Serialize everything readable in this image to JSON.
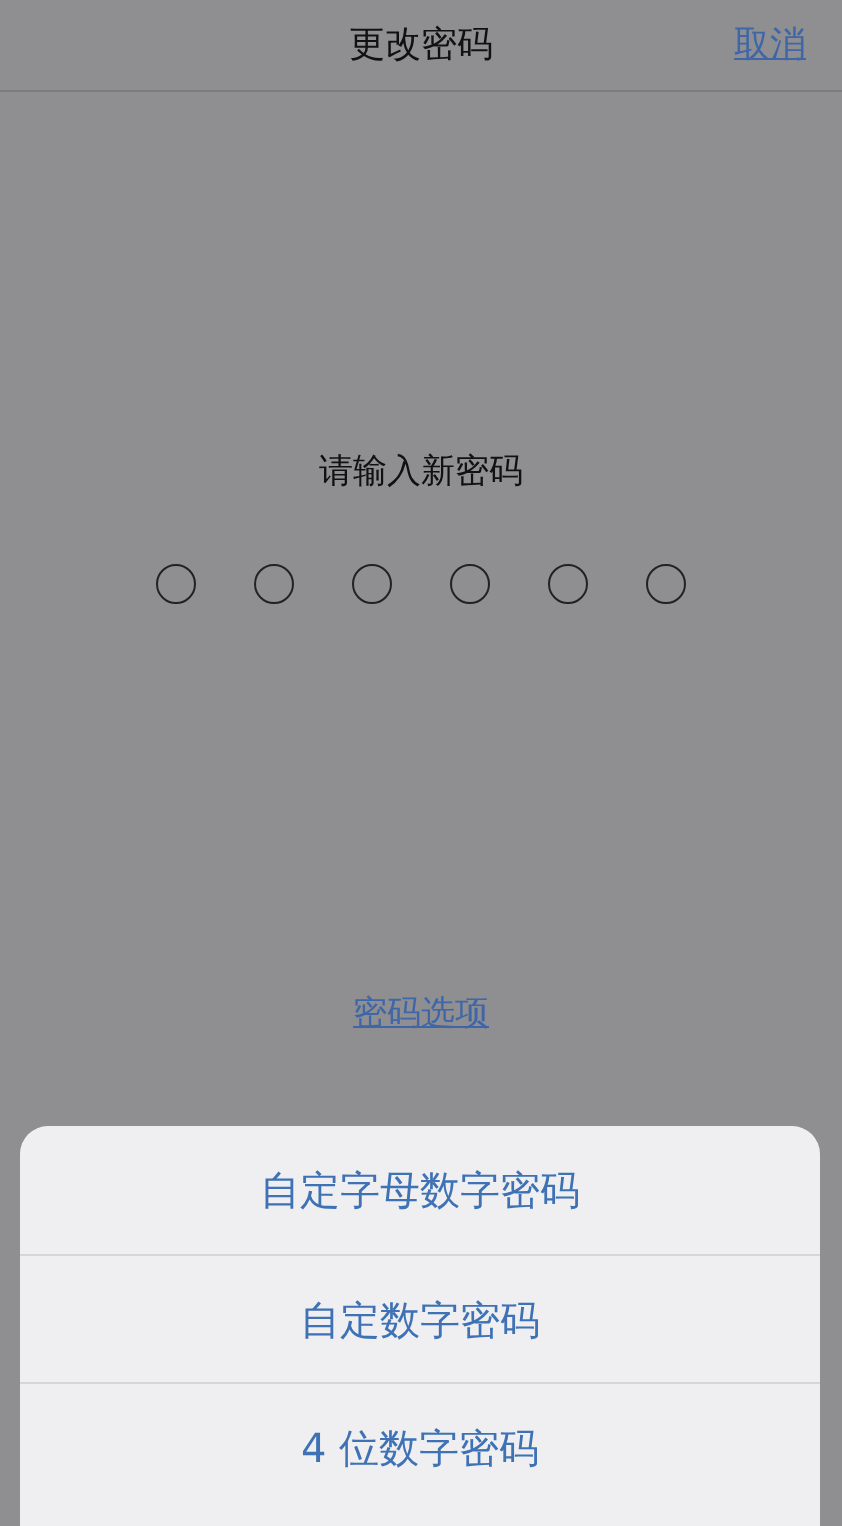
{
  "nav_bar": {
    "title": "更改密码",
    "cancel": "取消"
  },
  "prompt": "请输入新密码",
  "passcode_dots": [
    {
      "filled": false
    },
    {
      "filled": false
    },
    {
      "filled": false
    },
    {
      "filled": false
    },
    {
      "filled": false
    },
    {
      "filled": false
    }
  ],
  "options_link": "密码选项",
  "action_sheet": {
    "items": [
      "自定字母数字密码",
      "自定数字密码",
      "4 位数字密码"
    ]
  }
}
